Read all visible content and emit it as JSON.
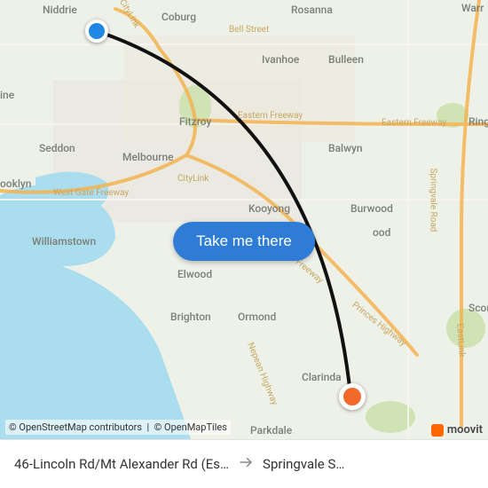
{
  "cta": {
    "label": "Take me there"
  },
  "attribution": {
    "osm": "© OpenStreetMap contributors",
    "tiles": "© OpenMapTiles"
  },
  "brand": {
    "name": "moovit"
  },
  "route": {
    "from_label": "46-Lincoln Rd/Mt Alexander Rd (Es…",
    "to_label": "Springvale S…"
  },
  "pins": {
    "start": {
      "name": "origin-pin",
      "color": "#1f87e5"
    },
    "end": {
      "name": "destination-pin",
      "color": "#f26a2a"
    }
  },
  "map_labels": {
    "niddrie": "Niddrie",
    "coburg": "Coburg",
    "rosanna": "Rosanna",
    "bellst": "Bell Street",
    "ivanhoe": "Ivanhoe",
    "bulleen": "Bulleen",
    "seddon": "Seddon",
    "fitzroy": "Fitzroy",
    "melbourne": "Melbourne",
    "easternfwy": "Eastern Freeway",
    "easternfwy2": "Eastern Freeway",
    "balwyn": "Balwyn",
    "ring": "Ring",
    "westgate": "West Gate Freeway",
    "citylink": "CityLink",
    "citylink2": "CityLink",
    "kooyong": "Kooyong",
    "burwood": "Burwood",
    "williamstown": "Williamstown",
    "elwood": "Elwood",
    "brighton": "Brighton",
    "ormond": "Ormond",
    "clarinda": "Clarinda",
    "parkdale": "Parkdale",
    "princes": "Princes Highway",
    "nepean": "Nepean Highway",
    "monash": "Monash Freeway",
    "springvalerd": "Springvale Road",
    "eastlink": "EastLink",
    "scor": "Scor",
    "warr": "Warr",
    "ooklyn": "ooklyn",
    "ine": "ine",
    "ood": "ood"
  }
}
